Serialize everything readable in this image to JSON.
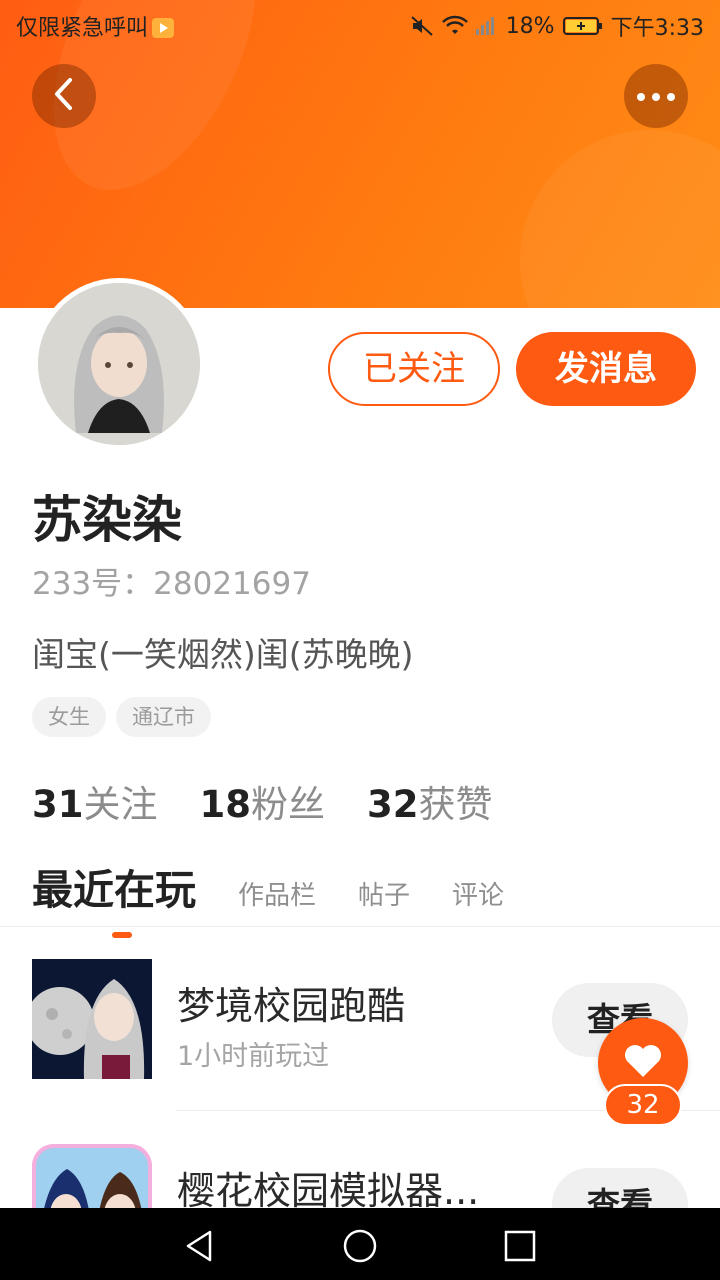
{
  "status_bar": {
    "left_text": "仅限紧急呼叫",
    "battery": "18%",
    "time": "下午3:33"
  },
  "profile": {
    "name": "苏染染",
    "uid": "233号：28021697",
    "bio": "闺宝(一笑烟然)闺(苏晚晚)",
    "tags": [
      "女生",
      "通辽市"
    ],
    "follow_label": "已关注",
    "message_label": "发消息"
  },
  "stats": [
    {
      "num": "31",
      "label": "关注"
    },
    {
      "num": "18",
      "label": "粉丝"
    },
    {
      "num": "32",
      "label": "获赞"
    }
  ],
  "tabs": [
    "最近在玩",
    "作品栏",
    "帖子",
    "评论"
  ],
  "games": [
    {
      "title": "梦境校园跑酷",
      "subtitle": "1小时前玩过",
      "button": "查看"
    },
    {
      "title": "樱花校园模拟器...",
      "subtitle": "",
      "button": "查看"
    }
  ],
  "like": {
    "count": "32"
  },
  "colors": {
    "accent": "#ff5a12",
    "header_gradient_start": "#ff5d12",
    "header_gradient_end": "#ff8d16"
  },
  "icons": {
    "back": "chevron-left-icon",
    "more": "more-dots-icon",
    "like": "heart-icon",
    "nav_back": "triangle-back-icon",
    "nav_home": "circle-home-icon",
    "nav_recent": "square-recent-icon"
  }
}
